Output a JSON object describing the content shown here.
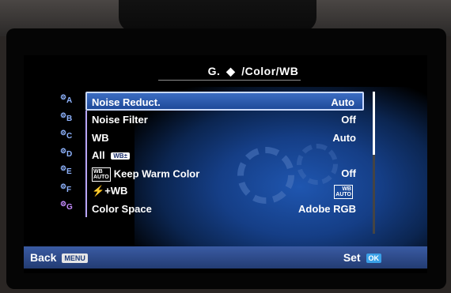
{
  "header": {
    "title_prefix": "G.",
    "title_icon": "camera-settings-icon",
    "title_text": "/Color/WB"
  },
  "tabs": [
    {
      "letter": "A",
      "icon": "gear-icon"
    },
    {
      "letter": "B",
      "icon": "gear-icon"
    },
    {
      "letter": "C",
      "icon": "gear-icon"
    },
    {
      "letter": "D",
      "icon": "gear-icon"
    },
    {
      "letter": "E",
      "icon": "gear-icon"
    },
    {
      "letter": "F",
      "icon": "gear-icon"
    },
    {
      "letter": "G",
      "icon": "gear-icon",
      "active": true
    }
  ],
  "menu": [
    {
      "label": "Noise Reduct.",
      "value": "Auto",
      "selected": true
    },
    {
      "label": "Noise Filter",
      "value": "Off"
    },
    {
      "label": "WB",
      "value": "Auto"
    },
    {
      "label": "All",
      "badge": "WB±",
      "value": ""
    },
    {
      "label": "Keep Warm Color",
      "prefix_icon": "auto-wb-icon",
      "value": "Off"
    },
    {
      "label": "+WB",
      "prefix_icon": "flash-icon",
      "value": "AUTO",
      "value_icon": "wb-auto-icon"
    },
    {
      "label": "Color Space",
      "value": "Adobe RGB"
    }
  ],
  "footer": {
    "back_label": "Back",
    "back_key": "MENU",
    "set_label": "Set",
    "set_key": "OK"
  }
}
